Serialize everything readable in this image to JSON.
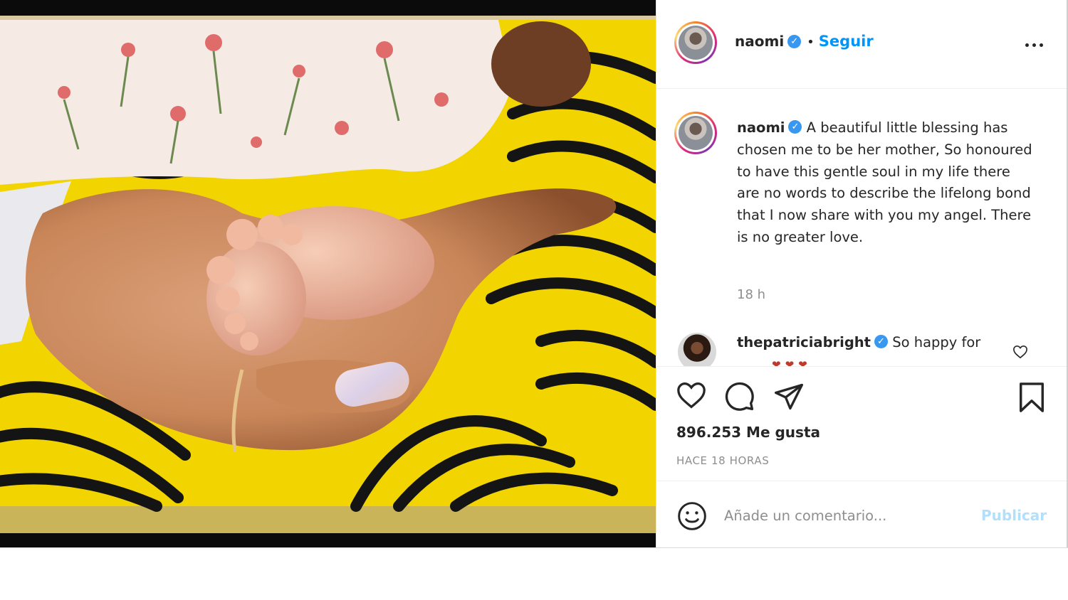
{
  "post": {
    "username": "naomi",
    "verified_icon": "verified-badge-icon",
    "separator": "•",
    "follow_label": "Seguir",
    "more_icon": "more-options-icon",
    "caption": "A beautiful little blessing has chosen me to be her mother, So honoured to have this gentle soul in my life there are no words to describe the lifelong bond that I now share with you my angel. There is no greater love.",
    "time_ago": "18 h",
    "photo_alt": "baby feet held in a hand"
  },
  "comments": [
    {
      "username": "thepatriciabright",
      "text": "So happy for",
      "emoji": "❤❤❤"
    }
  ],
  "actions": {
    "like_icon": "heart-icon",
    "comment_icon": "comment-icon",
    "share_icon": "share-icon",
    "save_icon": "bookmark-icon",
    "likes_text": "896.253 Me gusta",
    "posted_text": "HACE 18 HORAS"
  },
  "comment_box": {
    "emoji_icon": "emoji-icon",
    "placeholder": "Añade un comentario...",
    "publish_label": "Publicar"
  },
  "colors": {
    "accent": "#0095f6",
    "verified": "#3897f0",
    "publish_disabled": "#b2dffc",
    "photo_background": "#f2d400"
  }
}
